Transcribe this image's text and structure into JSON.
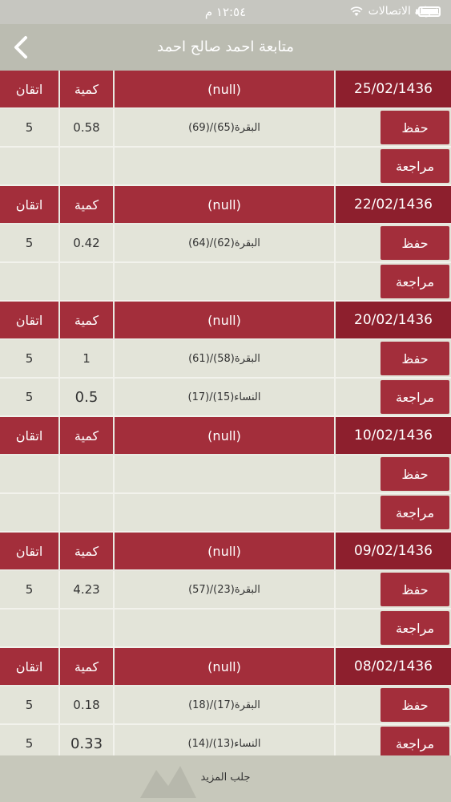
{
  "status": {
    "time": "١٢:٥٤ م",
    "carrier": "شركة الاتصالات"
  },
  "nav": {
    "title": "متابعة احمد صالح احمد",
    "back_icon": "chevron-left-icon"
  },
  "columns": {
    "itqan": "اتقان",
    "qty": "كمية"
  },
  "sessions": [
    {
      "date": "25/02/1436",
      "note": "(null)",
      "hifz": {
        "label": "حفظ",
        "text": "البقرة(65)/(69)",
        "qty": "0.58",
        "itqan": "5"
      },
      "review": {
        "label": "مراجعة",
        "text": "",
        "qty": "",
        "itqan": ""
      }
    },
    {
      "date": "22/02/1436",
      "note": "(null)",
      "hifz": {
        "label": "حفظ",
        "text": "البقرة(62)/(64)",
        "qty": "0.42",
        "itqan": "5"
      },
      "review": {
        "label": "مراجعة",
        "text": "",
        "qty": "",
        "itqan": ""
      }
    },
    {
      "date": "20/02/1436",
      "note": "(null)",
      "hifz": {
        "label": "حفظ",
        "text": "البقرة(58)/(61)",
        "qty": "1",
        "itqan": "5"
      },
      "review": {
        "label": "مراجعة",
        "text": "النساء(15)/(17)",
        "qty": "0.5",
        "itqan": "5"
      }
    },
    {
      "date": "10/02/1436",
      "note": "(null)",
      "hifz": {
        "label": "حفظ",
        "text": "",
        "qty": "",
        "itqan": ""
      },
      "review": {
        "label": "مراجعة",
        "text": "",
        "qty": "",
        "itqan": ""
      }
    },
    {
      "date": "09/02/1436",
      "note": "(null)",
      "hifz": {
        "label": "حفظ",
        "text": "البقرة(23)/(57)",
        "qty": "4.23",
        "itqan": "5"
      },
      "review": {
        "label": "مراجعة",
        "text": "",
        "qty": "",
        "itqan": ""
      }
    },
    {
      "date": "08/02/1436",
      "note": "(null)",
      "hifz": {
        "label": "حفظ",
        "text": "البقرة(17)/(18)",
        "qty": "0.18",
        "itqan": "5"
      },
      "review": {
        "label": "مراجعة",
        "text": "النساء(13)/(14)",
        "qty": "0.33",
        "itqan": "5"
      }
    }
  ],
  "footer": {
    "load_more": "جلب المزيد"
  },
  "colors": {
    "header_red": "#a32e3b",
    "date_dark_red": "#8d1f2d",
    "row_bg": "#e3e4d9"
  }
}
